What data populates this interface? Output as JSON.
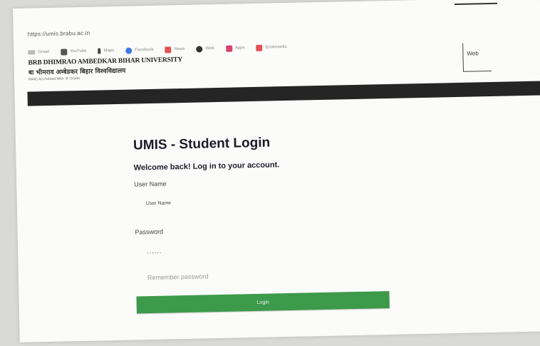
{
  "browser": {
    "url": "https://umis.brabu.ac.in",
    "bookmarks": [
      {
        "label": "Gmail",
        "icon": "mail-icon"
      },
      {
        "label": "YouTube",
        "icon": "n-icon"
      },
      {
        "label": "Maps",
        "icon": "pin-icon"
      },
      {
        "label": "Facebook",
        "icon": "globe-icon"
      },
      {
        "label": "News",
        "icon": "news-icon"
      },
      {
        "label": "Web",
        "icon": "web-icon"
      },
      {
        "label": "Apps",
        "icon": "apps-icon"
      },
      {
        "label": "Bookmarks",
        "icon": "bookmark-icon"
      }
    ]
  },
  "header": {
    "university_en": "BRB DHIMRAO AMBEDKAR BIHAR UNIVERSITY",
    "university_hi": "बा भीमराव अम्बेडकर बिहार विश्वविद्यालय",
    "accreditation": "NAAC Accredited With 'B' Grade",
    "web_label": "Web"
  },
  "login": {
    "title": "UMIS - Student Login",
    "subtitle": "Welcome back! Log in to your account.",
    "username_label": "User Name",
    "username_placeholder": "User Name",
    "password_label": "Password",
    "password_value": "......",
    "remember_label": "Remember password",
    "login_button": "Login"
  },
  "colors": {
    "navbar": "#252525",
    "login_button": "#3d9a4b"
  }
}
